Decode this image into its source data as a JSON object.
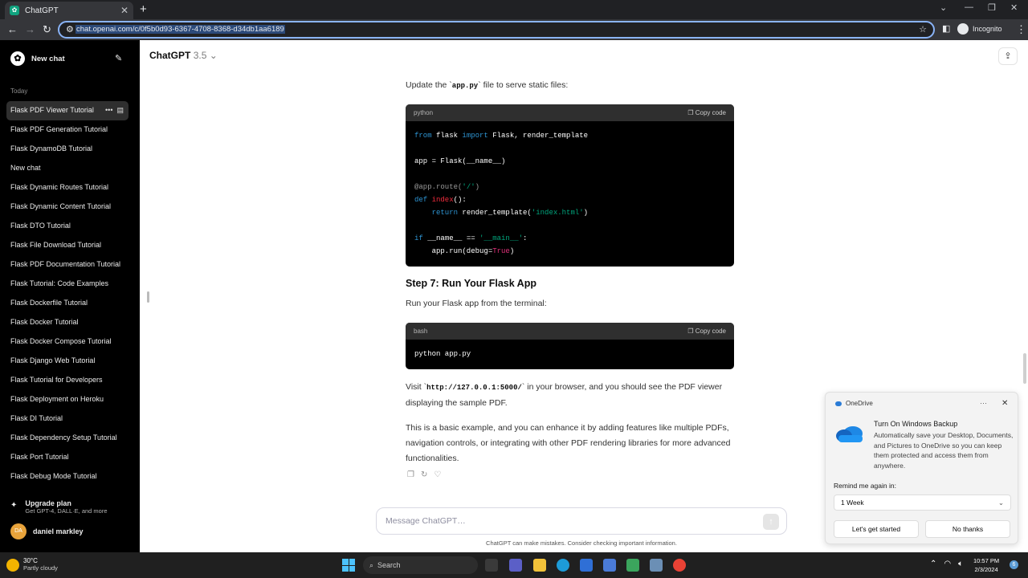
{
  "browser": {
    "tab_title": "ChatGPT",
    "url": "chat.openai.com/c/0f5b0d93-6367-4708-8368-d34db1aa6189",
    "profile": "Incognito"
  },
  "sidebar": {
    "new_chat": "New chat",
    "section_today": "Today",
    "items": [
      {
        "label": "Flask PDF Viewer Tutorial"
      },
      {
        "label": "Flask PDF Generation Tutorial"
      },
      {
        "label": "Flask DynamoDB Tutorial"
      },
      {
        "label": "New chat"
      },
      {
        "label": "Flask Dynamic Routes Tutorial"
      },
      {
        "label": "Flask Dynamic Content Tutorial"
      },
      {
        "label": "Flask DTO Tutorial"
      },
      {
        "label": "Flask File Download Tutorial"
      },
      {
        "label": "Flask PDF Documentation Tutorial"
      },
      {
        "label": "Flask Tutorial: Code Examples"
      },
      {
        "label": "Flask Dockerfile Tutorial"
      },
      {
        "label": "Flask Docker Tutorial"
      },
      {
        "label": "Flask Docker Compose Tutorial"
      },
      {
        "label": "Flask Django Web Tutorial"
      },
      {
        "label": "Flask Tutorial for Developers"
      },
      {
        "label": "Flask Deployment on Heroku"
      },
      {
        "label": "Flask DI Tutorial"
      },
      {
        "label": "Flask Dependency Setup Tutorial"
      },
      {
        "label": "Flask Port Tutorial"
      },
      {
        "label": "Flask Debug Mode Tutorial"
      }
    ],
    "upgrade_title": "Upgrade plan",
    "upgrade_sub": "Get GPT-4, DALL·E, and more",
    "user_initials": "DA",
    "user_name": "daniel markley"
  },
  "header": {
    "title": "ChatGPT",
    "version": "3.5"
  },
  "content": {
    "para1_pre": "Update the `",
    "para1_code": "app.py",
    "para1_post": "` file to serve static files:",
    "code1_lang": "python",
    "copy_label": "Copy code",
    "step_heading": "Step 7: Run Your Flask App",
    "para2": "Run your Flask app from the terminal:",
    "code2_lang": "bash",
    "code2_text": "python app.py",
    "para3_pre": "Visit `",
    "para3_code": "http://127.0.0.1:5000/",
    "para3_post": "` in your browser, and you should see the PDF viewer displaying the sample PDF.",
    "para4": "This is a basic example, and you can enhance it by adding features like multiple PDFs, navigation controls, or integrating with other PDF rendering libraries for more advanced functionalities."
  },
  "composer": {
    "placeholder": "Message ChatGPT…",
    "disclaimer": "ChatGPT can make mistakes. Consider checking important information."
  },
  "onedrive": {
    "app": "OneDrive",
    "title": "Turn On Windows Backup",
    "body": "Automatically save your Desktop, Documents, and Pictures to OneDrive so you can keep them protected and access them from anywhere.",
    "remind_label": "Remind me again in:",
    "remind_value": "1 Week",
    "primary": "Let's get started",
    "secondary": "No thanks"
  },
  "taskbar": {
    "temp": "30°C",
    "weather": "Partly cloudy",
    "search": "Search",
    "time": "10:57 PM",
    "date": "2/3/2024",
    "notifications": "6"
  },
  "colors": {
    "accent": "#10a37f",
    "sidebar_bg": "#000000",
    "code_bg": "#000000"
  }
}
